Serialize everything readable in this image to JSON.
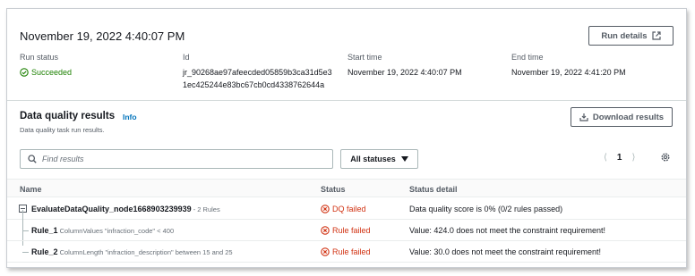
{
  "run": {
    "title": "November 19, 2022 4:40:07 PM",
    "details_button": "Run details",
    "fields": {
      "status_label": "Run status",
      "status_value": "Succeeded",
      "id_label": "Id",
      "id_value_line1": "jr_90268ae97afeecded05859b3ca31d5e3",
      "id_value_line2": "1ec425244e83bc67cb0cd4338762644a",
      "start_label": "Start time",
      "start_value": "November 19, 2022 4:40:07 PM",
      "end_label": "End time",
      "end_value": "November 19, 2022 4:41:20 PM"
    }
  },
  "results": {
    "title": "Data quality results",
    "info": "Info",
    "description": "Data quality task run results.",
    "download_button": "Download results",
    "search_placeholder": "Find results",
    "status_filter": "All statuses",
    "page": "1"
  },
  "table": {
    "headers": {
      "name": "Name",
      "status": "Status",
      "detail": "Status detail"
    },
    "rows": [
      {
        "name": "EvaluateDataQuality_node1668903239939",
        "sub": " - 2 Rules",
        "status": "DQ failed",
        "detail": "Data quality score is 0% (0/2 rules passed)"
      },
      {
        "name": "Rule_1",
        "sub": " ColumnValues \"infraction_code\" < 400",
        "status": "Rule failed",
        "detail": "Value: 424.0 does not meet the constraint requirement!"
      },
      {
        "name": "Rule_2",
        "sub": " ColumnLength \"infraction_description\" between 15 and 25",
        "status": "Rule failed",
        "detail": "Value: 30.0 does not meet the constraint requirement!"
      }
    ]
  },
  "colors": {
    "success": "#1d8102",
    "error": "#d13212",
    "link": "#0073bb"
  }
}
